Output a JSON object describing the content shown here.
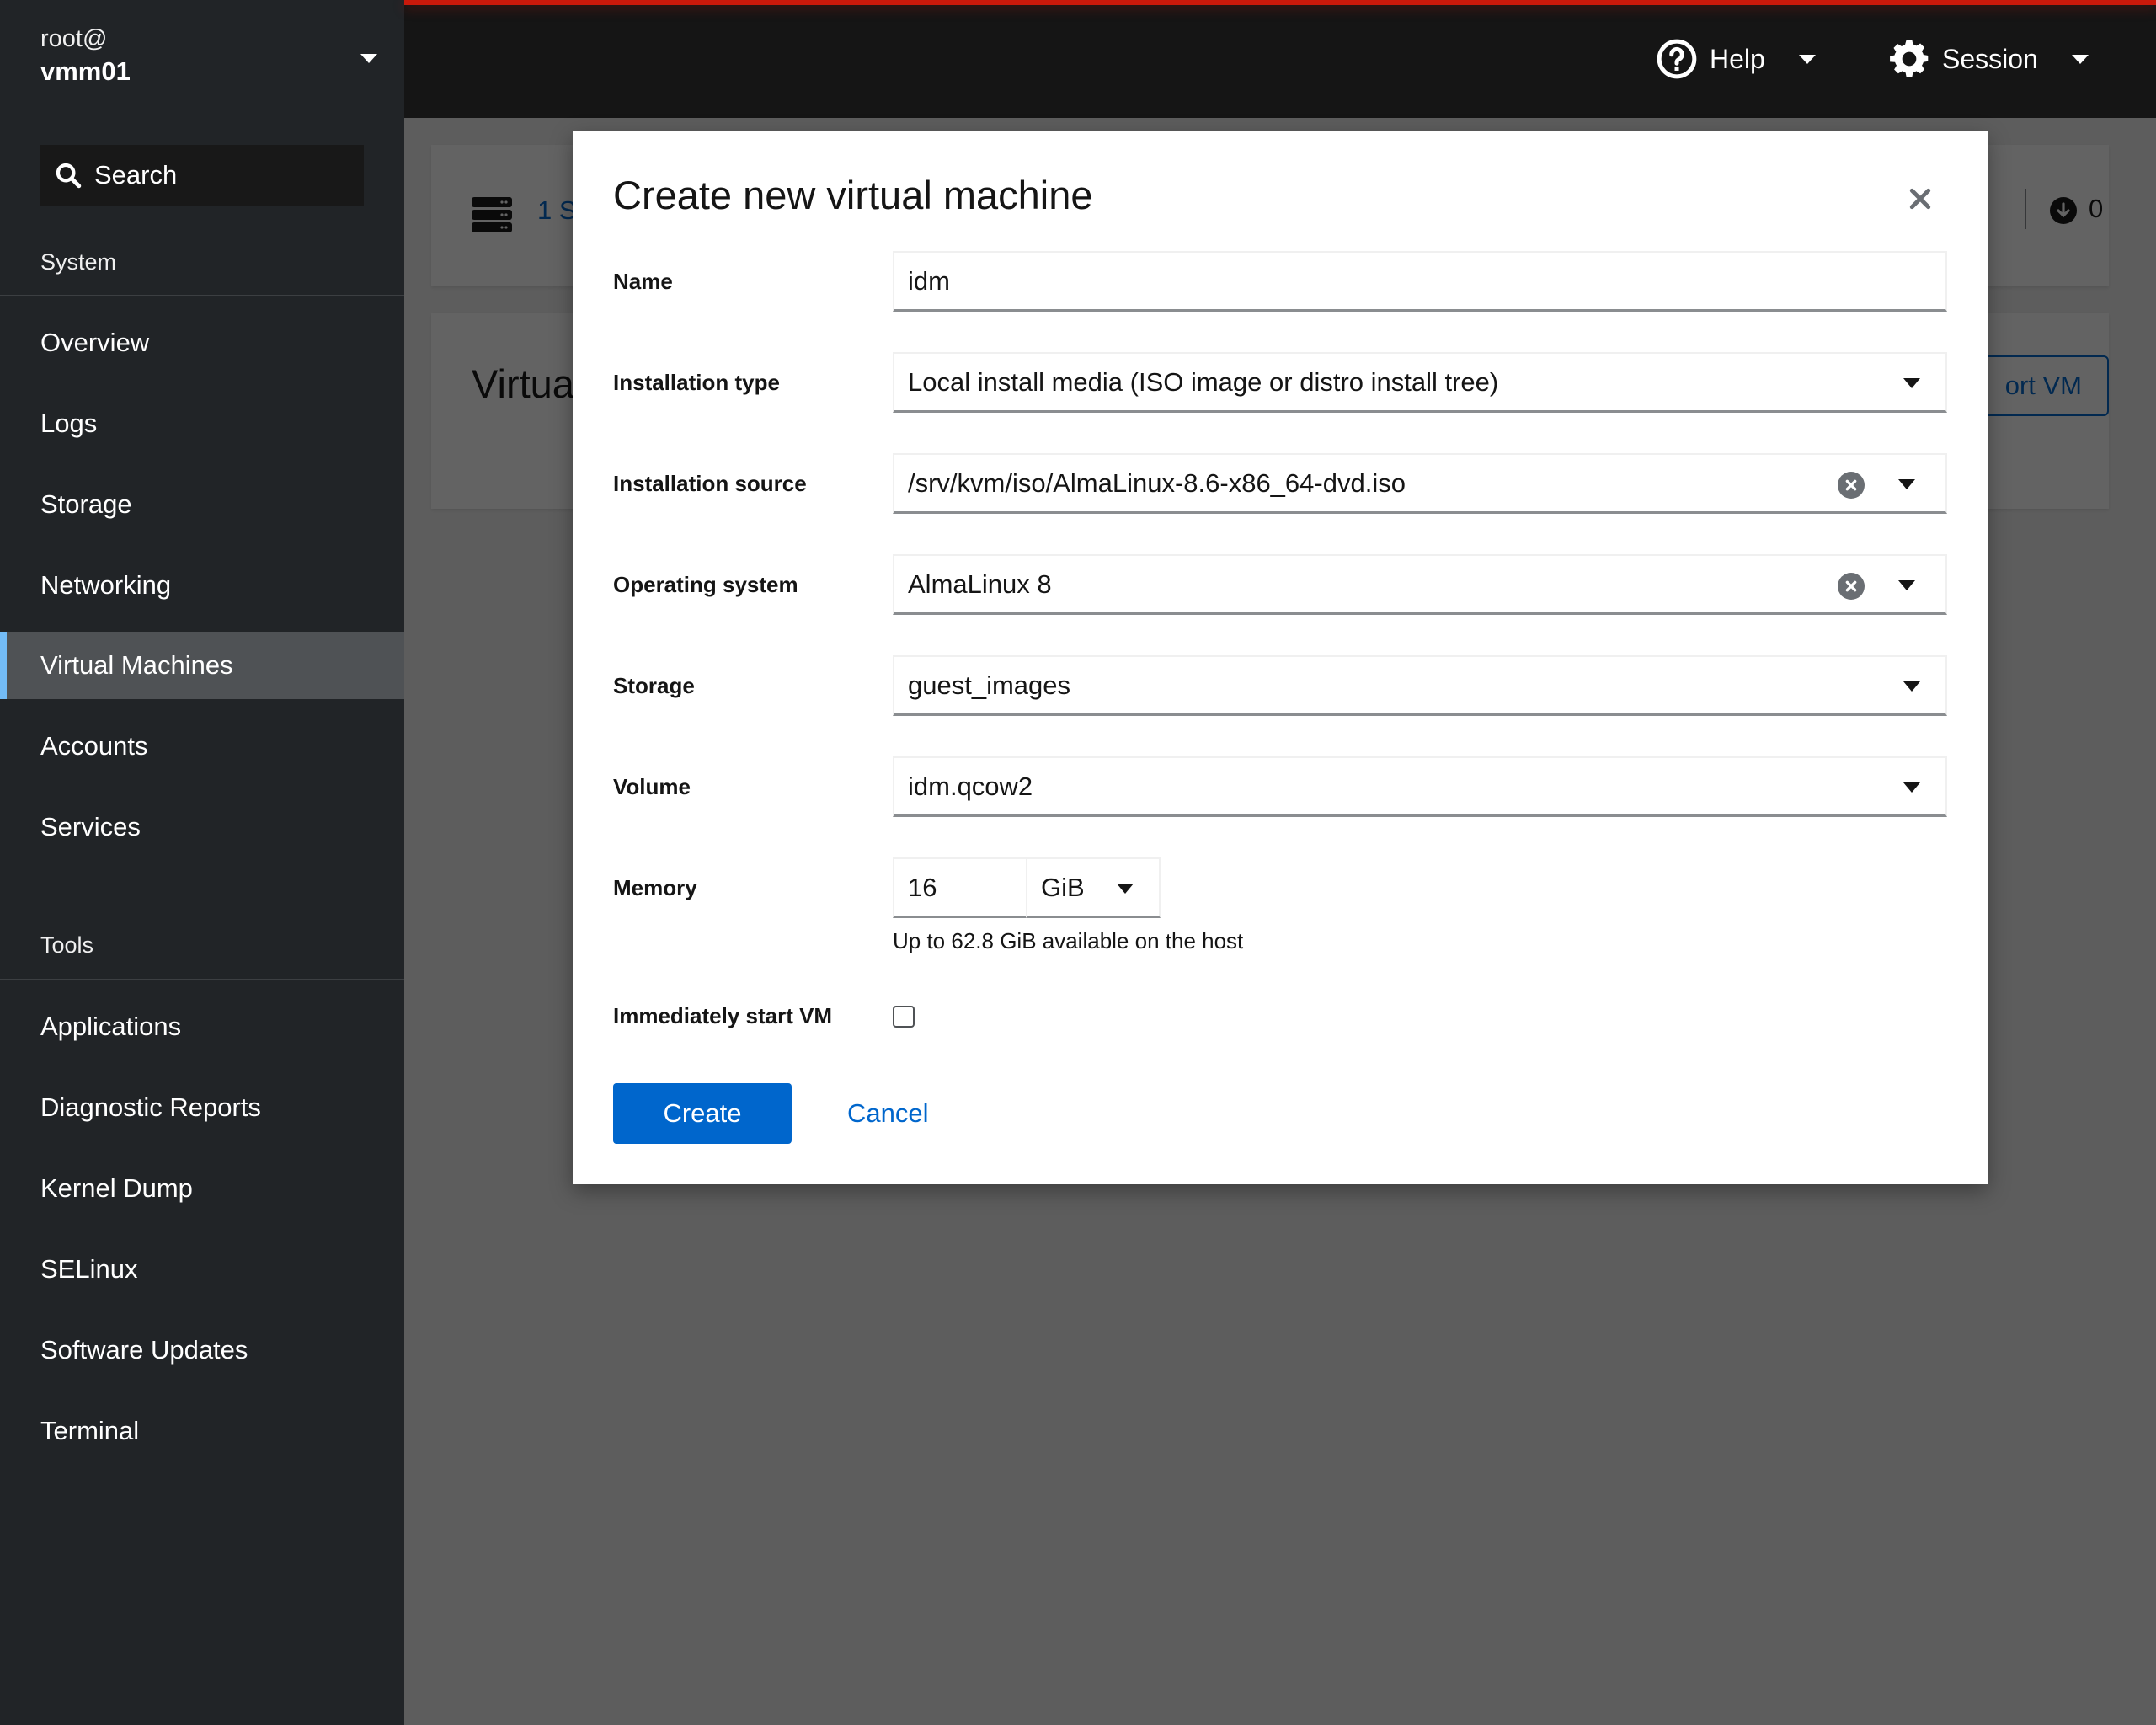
{
  "sidebar": {
    "host_user": "root@",
    "host_name": "vmm01",
    "search_label": "Search",
    "sections": [
      {
        "title": "System",
        "items": [
          {
            "label": "Overview",
            "active": false
          },
          {
            "label": "Logs",
            "active": false
          },
          {
            "label": "Storage",
            "active": false
          },
          {
            "label": "Networking",
            "active": false
          },
          {
            "label": "Virtual Machines",
            "active": true
          },
          {
            "label": "Accounts",
            "active": false
          },
          {
            "label": "Services",
            "active": false
          }
        ]
      },
      {
        "title": "Tools",
        "items": [
          {
            "label": "Applications",
            "active": false
          },
          {
            "label": "Diagnostic Reports",
            "active": false
          },
          {
            "label": "Kernel Dump",
            "active": false
          },
          {
            "label": "SELinux",
            "active": false
          },
          {
            "label": "Software Updates",
            "active": false
          },
          {
            "label": "Terminal",
            "active": false
          }
        ]
      }
    ]
  },
  "header": {
    "help_label": "Help",
    "session_label": "Session"
  },
  "background": {
    "storage_pools_partial": "1 S",
    "page_heading_partial": "Virtua",
    "import_vm_partial": "ort VM",
    "download_count": "0"
  },
  "modal": {
    "title": "Create new virtual machine",
    "fields": {
      "name": {
        "label": "Name",
        "value": "idm"
      },
      "installation_type": {
        "label": "Installation type",
        "value": "Local install media (ISO image or distro install tree)"
      },
      "installation_source": {
        "label": "Installation source",
        "value": "/srv/kvm/iso/AlmaLinux-8.6-x86_64-dvd.iso"
      },
      "operating_system": {
        "label": "Operating system",
        "value": "AlmaLinux 8"
      },
      "storage": {
        "label": "Storage",
        "value": "guest_images"
      },
      "volume": {
        "label": "Volume",
        "value": "idm.qcow2"
      },
      "memory": {
        "label": "Memory",
        "value": "16",
        "unit": "GiB",
        "helper": "Up to 62.8 GiB available on the host"
      },
      "start_vm": {
        "label": "Immediately start VM",
        "checked": false
      }
    },
    "create_label": "Create",
    "cancel_label": "Cancel"
  },
  "colors": {
    "primary": "#0066cc",
    "sidebar_bg": "#212427",
    "header_bg": "#151515",
    "accent_red": "#c9190b",
    "active_indicator": "#73bcf7"
  }
}
